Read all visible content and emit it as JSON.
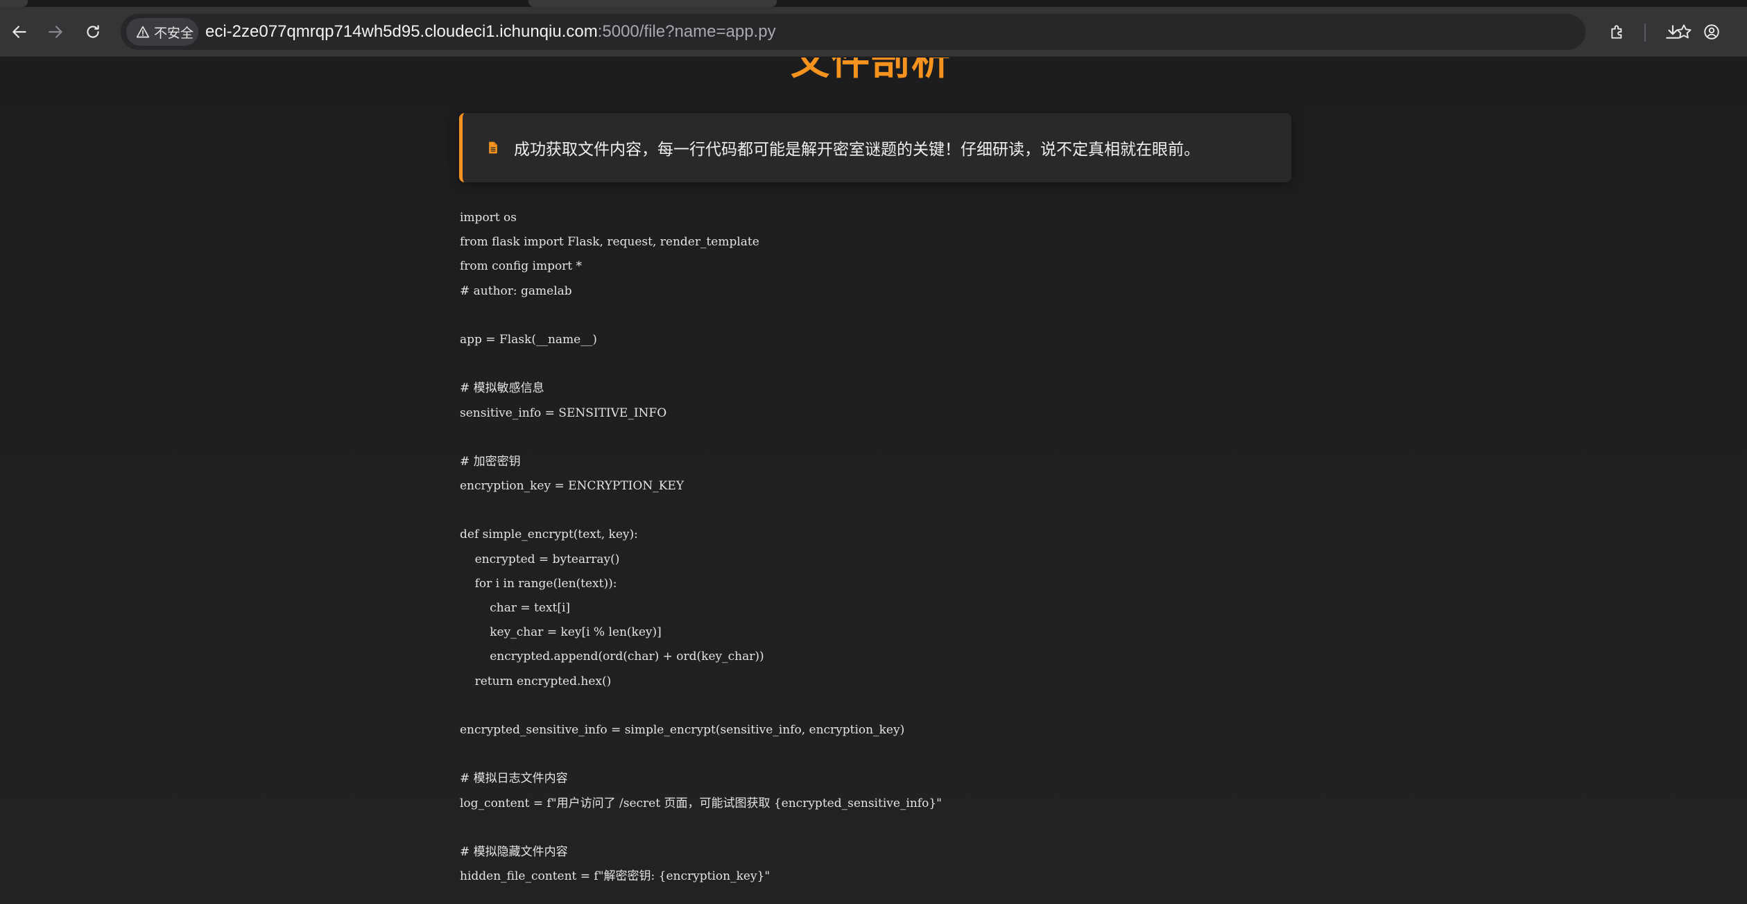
{
  "browser": {
    "security_chip": "不安全",
    "url_host": "eci-2ze077qmrqp714wh5d95.cloudeci1.ichunqiu.com",
    "url_rest": ":5000/file?name=app.py",
    "icons": {
      "back": "back-arrow-icon",
      "forward": "forward-arrow-icon",
      "reload": "reload-icon",
      "warning": "warning-icon",
      "bookmark": "star-icon",
      "extensions": "puzzle-icon",
      "downloads": "download-icon",
      "profile": "profile-icon"
    }
  },
  "page": {
    "title": "文件剖析",
    "notice_icon": "file-icon",
    "notice": "成功获取文件内容，每一行代码都可能是解开密室谜题的关键！仔细研读，说不定真相就在眼前。",
    "accent_color": "#f6931e",
    "code_lines": [
      "import os",
      "from flask import Flask, request, render_template",
      "from config import *",
      "# author: gamelab",
      "",
      "app = Flask(__name__)",
      "",
      "# 模拟敏感信息",
      "sensitive_info = SENSITIVE_INFO",
      "",
      "# 加密密钥",
      "encryption_key = ENCRYPTION_KEY",
      "",
      "def simple_encrypt(text, key):",
      "    encrypted = bytearray()",
      "    for i in range(len(text)):",
      "        char = text[i]",
      "        key_char = key[i % len(key)]",
      "        encrypted.append(ord(char) + ord(key_char))",
      "    return encrypted.hex()",
      "",
      "encrypted_sensitive_info = simple_encrypt(sensitive_info, encryption_key)",
      "",
      "# 模拟日志文件内容",
      "log_content = f\"用户访问了 /secret 页面，可能试图获取 {encrypted_sensitive_info}\"",
      "",
      "# 模拟隐藏文件内容",
      "hidden_file_content = f\"解密密钥: {encryption_key}\""
    ]
  }
}
